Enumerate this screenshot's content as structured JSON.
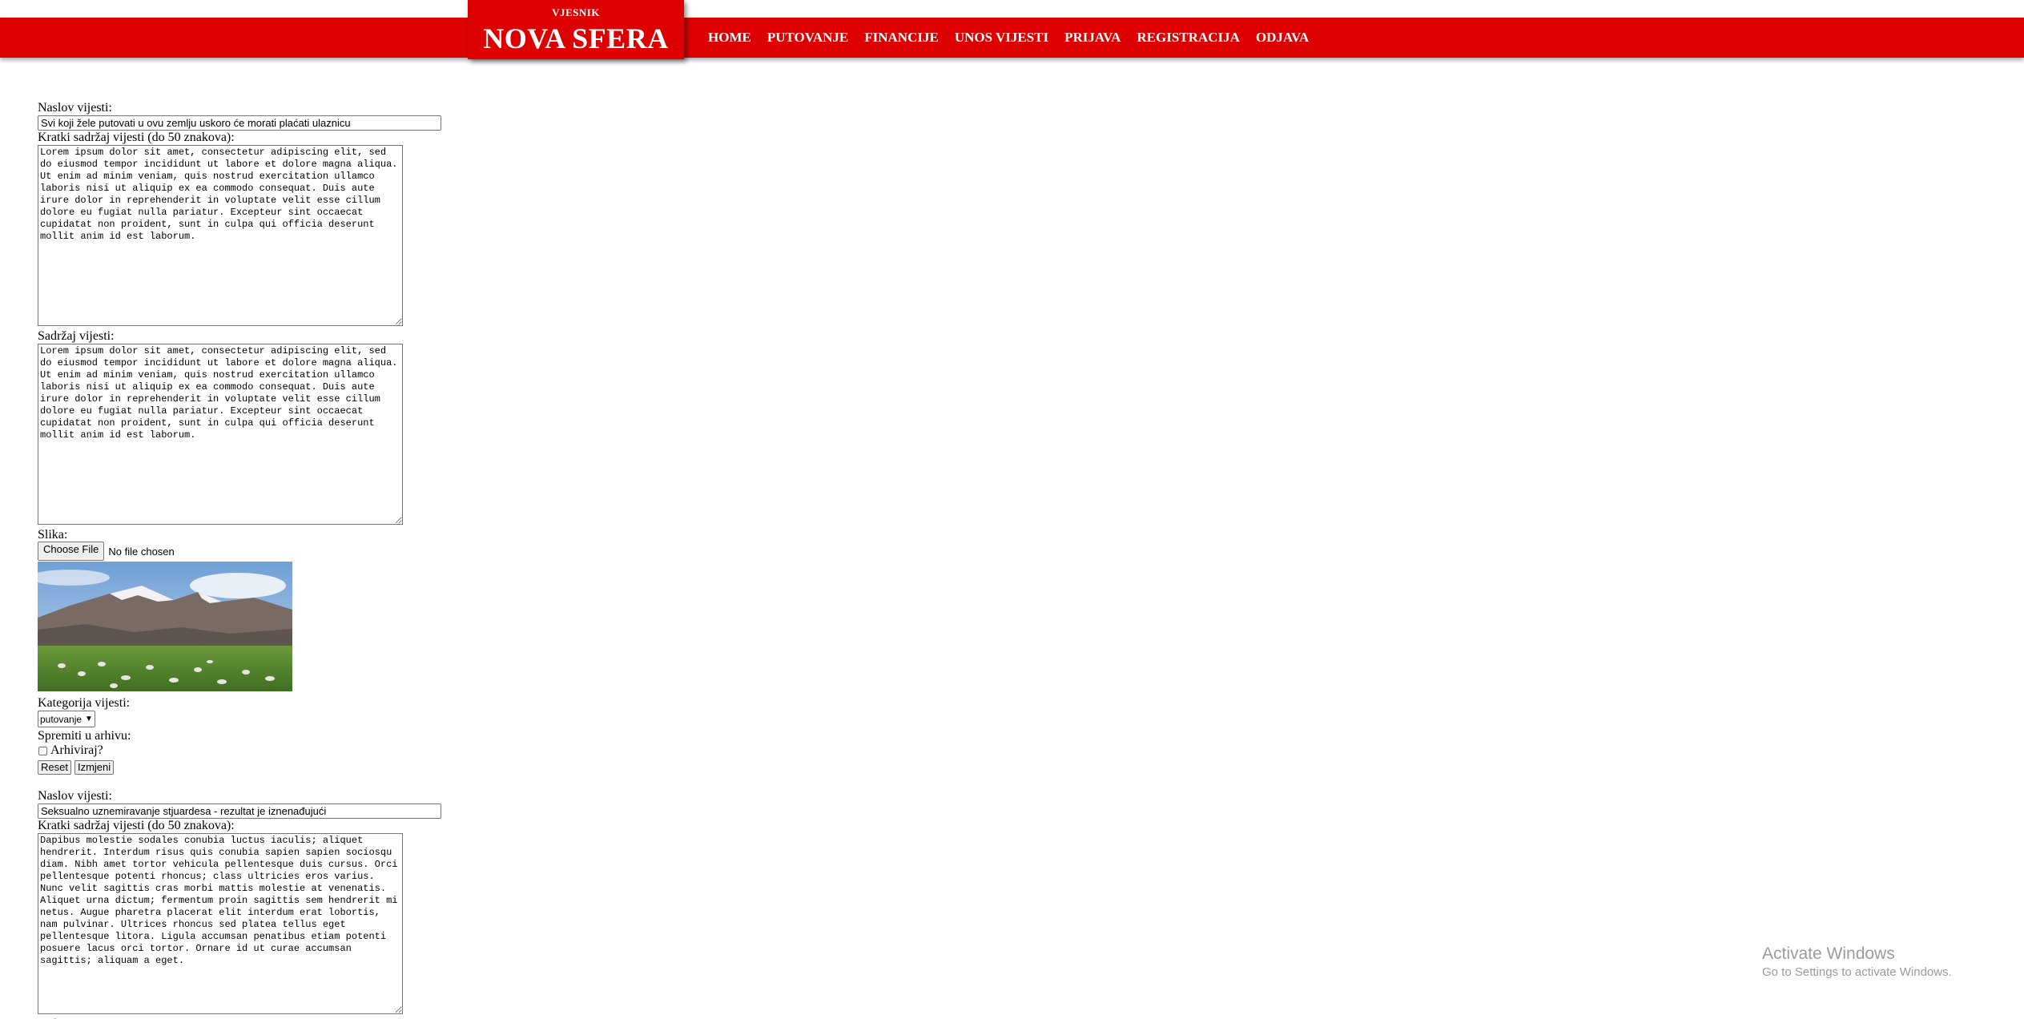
{
  "header": {
    "logo_small": "VJESNIK",
    "logo_big": "NOVA SFERA",
    "nav": [
      "HOME",
      "PUTOVANJE",
      "FINANCIJE",
      "UNOS VIJESTI",
      "PRIJAVA",
      "REGISTRACIJA",
      "ODJAVA"
    ]
  },
  "labels": {
    "title": "Naslov vijesti:",
    "summary": "Kratki sadržaj vijesti (do 50 znakova):",
    "content": "Sadržaj vijesti:",
    "image": "Slika:",
    "category": "Kategorija vijesti:",
    "archive": "Spremiti u arhivu:",
    "archive_checkbox": "Arhiviraj?",
    "choose_file": "Choose File",
    "no_file": "No file chosen",
    "reset": "Reset",
    "edit": "Izmjeni"
  },
  "articles": [
    {
      "title": "Svi koji žele putovati u ovu zemlju uskoro će morati plaćati ulaznicu",
      "summary": "Lorem ipsum dolor sit amet, consectetur adipiscing elit, sed do eiusmod tempor incididunt ut labore et dolore magna aliqua. Ut enim ad minim veniam, quis nostrud exercitation ullamco laboris nisi ut aliquip ex ea commodo consequat. Duis aute irure dolor in reprehenderit in voluptate velit esse cillum dolore eu fugiat nulla pariatur. Excepteur sint occaecat cupidatat non proident, sunt in culpa qui officia deserunt mollit anim id est laborum.",
      "content": "Lorem ipsum dolor sit amet, consectetur adipiscing elit, sed do eiusmod tempor incididunt ut labore et dolore magna aliqua. Ut enim ad minim veniam, quis nostrud exercitation ullamco laboris nisi ut aliquip ex ea commodo consequat. Duis aute irure dolor in reprehenderit in voluptate velit esse cillum dolore eu fugiat nulla pariatur. Excepteur sint occaecat cupidatat non proident, sunt in culpa qui officia deserunt mollit anim id est laborum.",
      "category": "putovanje"
    },
    {
      "title": "Seksualno uznemiravanje stjuardesa - rezultat je iznenađujući",
      "summary": "Dapibus molestie sodales conubia luctus iaculis; aliquet hendrerit. Interdum risus quis conubia sapien sapien sociosqu diam. Nibh amet tortor vehicula pellentesque duis cursus. Orci pellentesque potenti rhoncus; class ultricies eros varius. Nunc velit sagittis cras morbi mattis molestie at venenatis. Aliquet urna dictum; fermentum proin sagittis sem hendrerit mi netus. Augue pharetra placerat elit interdum erat lobortis, nam pulvinar. Ultrices rhoncus sed platea tellus eget pellentesque litora. Ligula accumsan penatibus etiam potenti posuere lacus orci tortor. Ornare id ut curae accumsan sagittis; aliquam a eget."
    }
  ],
  "watermark": {
    "title": "Activate Windows",
    "subtitle": "Go to Settings to activate Windows."
  },
  "colors": {
    "brand_red": "#dd0000"
  }
}
